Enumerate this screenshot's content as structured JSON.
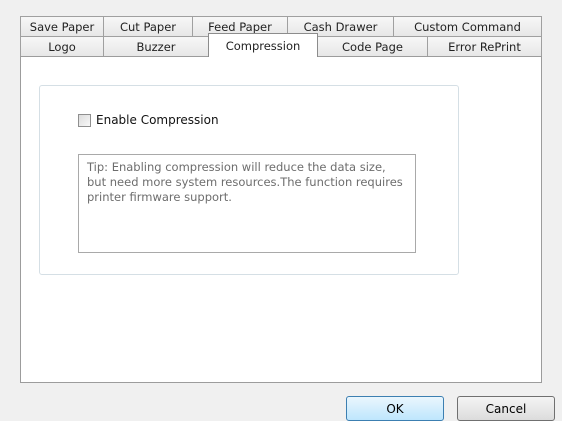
{
  "tabs": {
    "row1": [
      {
        "label": "Save Paper"
      },
      {
        "label": "Cut Paper"
      },
      {
        "label": "Feed Paper"
      },
      {
        "label": "Cash Drawer"
      },
      {
        "label": "Custom Command"
      }
    ],
    "row2": [
      {
        "label": "Logo"
      },
      {
        "label": "Buzzer"
      },
      {
        "label": "Compression"
      },
      {
        "label": "Code Page"
      },
      {
        "label": "Error RePrint"
      }
    ],
    "active": "Compression"
  },
  "compression": {
    "enable_label": "Enable Compression",
    "enabled": false,
    "tip": "Tip: Enabling compression will reduce the data size, but need more system resources.The function requires printer firmware support."
  },
  "buttons": {
    "ok": "OK",
    "cancel": "Cancel"
  }
}
